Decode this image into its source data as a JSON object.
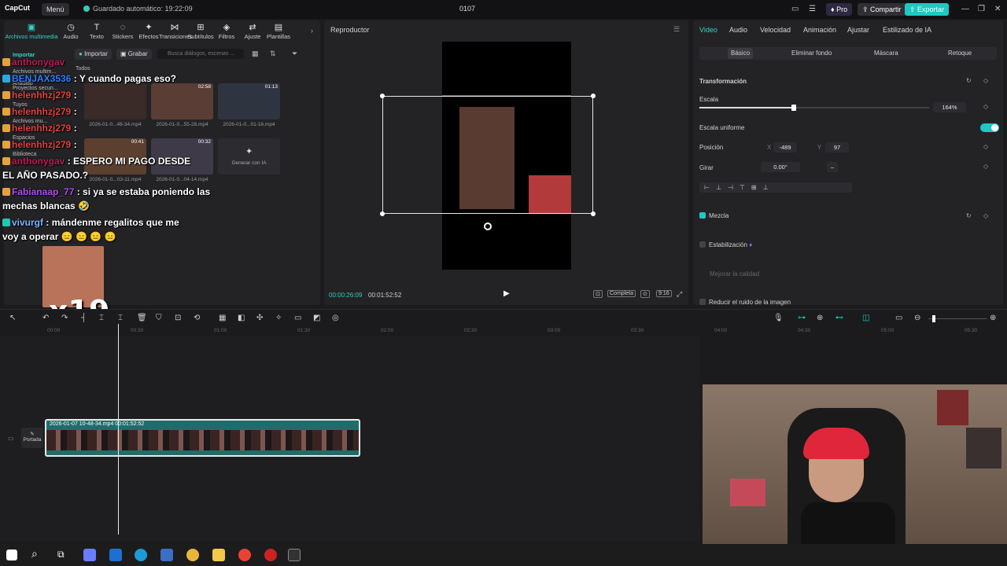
{
  "titlebar": {
    "logo": "CapCut",
    "menu": "Menú",
    "autosave": "Guardado automático: 19:22:09",
    "project": "0107",
    "pro": "Pro",
    "share": "Compartir",
    "export": "Exportar"
  },
  "media": {
    "tabs": [
      "Archivos multimedia",
      "Audio",
      "Texto",
      "Stickers",
      "Efectos",
      "Transiciones",
      "Subtítulos",
      "Filtros",
      "Ajuste",
      "Plantillas"
    ],
    "tab_icons": [
      "▣",
      "◷",
      "T",
      "◌",
      "✦",
      "⋈",
      "⊞",
      "◈",
      "⇄",
      "▤"
    ],
    "sidebar": [
      "Importar",
      "Archivos multim...",
      "Añadido",
      "Proyectos secun...",
      "Tuyos",
      "Archivos mu...",
      "Espacios",
      "Biblioteca"
    ],
    "import_btn": "Importar",
    "record_btn": "Grabar",
    "search_placeholder": "Busca diálogos, escenas ...",
    "all_label": "Todos",
    "thumbs": [
      {
        "name": "2026-01-0...48-34.mp4",
        "dur": ""
      },
      {
        "name": "2026-01-0...55-28.mp4",
        "dur": "02:58"
      },
      {
        "name": "2026-01-0...01-16.mp4",
        "dur": "01:13"
      },
      {
        "name": "2026-01-0...03-11.mp4",
        "dur": "00:41"
      },
      {
        "name": "2026-01-0...04-14.mp4",
        "dur": "00:32"
      }
    ],
    "generate_ai": "Generar con IA"
  },
  "chat": [
    {
      "user": "anthonygav",
      "text": "",
      "color": "#c2185b"
    },
    {
      "user": "BENJAX3536",
      "text": ": Y cuando pagas eso?",
      "color": "#2f7fff"
    },
    {
      "user": "helenhhzj279",
      "text": ":",
      "color": "#e0403f"
    },
    {
      "user": "helenhhzj279",
      "text": ":",
      "color": "#e0403f"
    },
    {
      "user": "helenhhzj279",
      "text": ":",
      "color": "#e0403f"
    },
    {
      "user": "helenhhzj279",
      "text": ":",
      "color": "#e0403f"
    },
    {
      "user": "anthonygav",
      "text": ": ESPERO MI PAGO DESDE",
      "color": "#c2185b"
    },
    {
      "user": "",
      "text": "EL AÑO PASADO.?",
      "color": "#ffffff"
    },
    {
      "user": "Fabianaap_77",
      "text": ": si ya se estaba poniendo las",
      "color": "#b24bf3"
    },
    {
      "user": "",
      "text": "mechas blancas 🤣",
      "color": "#ffffff"
    },
    {
      "user": "vivurgf",
      "text": ": mándenme regalitos que me",
      "color": "#7fb3ff"
    },
    {
      "user": "",
      "text": "voy a operar 😑 😑 😑 😑",
      "color": "#ffffff"
    }
  ],
  "emote_count": "x19",
  "player": {
    "title": "Reproductor",
    "time_current": "00:00:26:09",
    "time_total": "00:01:52:52",
    "full_label": "Completa",
    "ratio_label": "9:16"
  },
  "inspector": {
    "tabs": [
      "Video",
      "Audio",
      "Velocidad",
      "Animación",
      "Ajustar",
      "Estilizado de IA"
    ],
    "subtabs": [
      "Básico",
      "Eliminar fondo",
      "Máscara",
      "Retoque"
    ],
    "transform": "Transformación",
    "scale_label": "Escala",
    "scale_value": "164%",
    "uniform_scale": "Escala uniforme",
    "position_label": "Posición",
    "pos_x_label": "X",
    "pos_x": "-489",
    "pos_y_label": "Y",
    "pos_y": "97",
    "rotate_label": "Girar",
    "rotate_value": "0.00°",
    "blend": "Mezcla",
    "stabilize": "Estabilización",
    "improve_quality": "Mejorar la calidad",
    "reduce_noise": "Reducir el ruido de la imagen",
    "scale_fraction": 0.41
  },
  "timeline": {
    "ruler": [
      "00:00",
      "00:30",
      "01:00",
      "01:30",
      "02:00",
      "02:30",
      "03:00",
      "03:30",
      "04:00",
      "04:30",
      "05:00",
      "05:30"
    ],
    "cover_label": "Portada",
    "clip_name": "2026-01-07 10-48-34.mp4",
    "clip_duration": "00:01:52:52"
  },
  "colors": {
    "accent": "#1fc8c2",
    "panel": "#232326"
  }
}
